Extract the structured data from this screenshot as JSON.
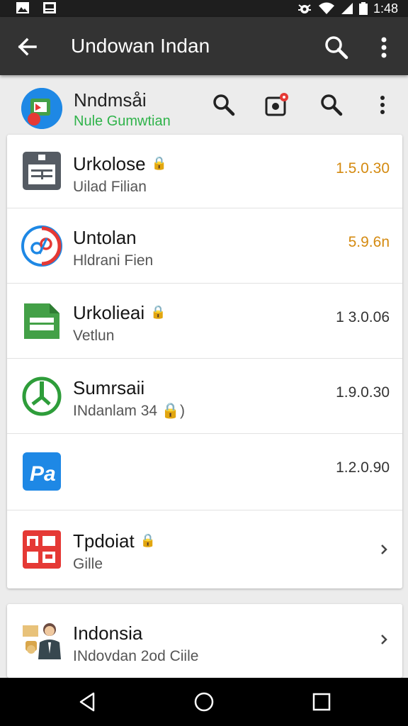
{
  "status_bar": {
    "time": "1:48",
    "left_icons": [
      "image-icon",
      "gallery-icon"
    ],
    "right_icons": [
      "bug-icon",
      "wifi-icon",
      "signal-icon",
      "battery-icon"
    ]
  },
  "app_bar": {
    "title": "Undowan Indan",
    "back_icon": "arrow-back-icon",
    "search_icon": "search-icon",
    "more_icon": "more-vert-icon"
  },
  "header": {
    "title": "Nndmsåi",
    "subtitle": "Nule Gumwtian",
    "actions": [
      "search-icon",
      "camera-notification-icon",
      "search-icon",
      "more-vert-icon"
    ],
    "colors": {
      "subtitle": "#2fb34a",
      "notification_badge": "#e53935"
    }
  },
  "list": {
    "items": [
      {
        "name": "Urkolose",
        "lock": "🔒",
        "desc": "Uilad Filian",
        "version": "1.5.0.30",
        "version_color": "orange",
        "icon": "document-app-icon"
      },
      {
        "name": "Untolan",
        "lock": "",
        "desc": "Hldrani Fien",
        "version": "5.9.6n",
        "version_color": "orange",
        "icon": "link-app-icon"
      },
      {
        "name": "Urkolieai",
        "lock": "🔒",
        "desc": "Vetlun",
        "version": "1 3.0.06",
        "version_color": "normal",
        "icon": "sheet-app-icon"
      },
      {
        "name": "Sumrsaii",
        "lock": "",
        "desc": "INdanlam 34 🔒)",
        "version": "1.9.0.30",
        "version_color": "normal",
        "icon": "power-app-icon"
      },
      {
        "name": "",
        "lock": "",
        "desc": "",
        "version": "1.2.0.90",
        "version_color": "normal",
        "icon": "pa-app-icon"
      },
      {
        "name": "Tpdoiat",
        "lock": "🔒",
        "desc": "Gille",
        "version": "",
        "version_color": "normal",
        "icon": "grid-app-icon",
        "chevron": true
      }
    ]
  },
  "bottom_card": {
    "name": "Indonsia",
    "desc": "INdovdan 2od Ciile",
    "icon": "person-avatar-icon",
    "chevron": true
  },
  "nav_bar": {
    "buttons": [
      "back-triangle-icon",
      "home-circle-icon",
      "recents-square-icon"
    ]
  }
}
